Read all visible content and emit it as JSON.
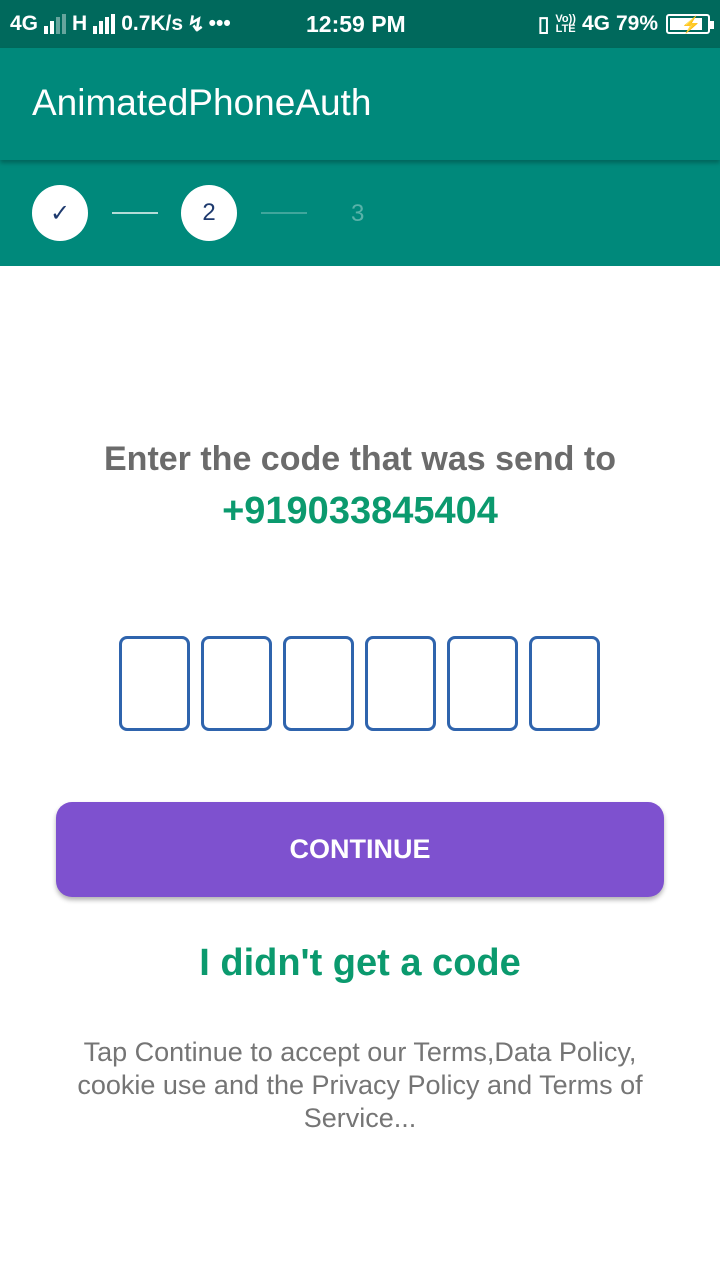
{
  "status_bar": {
    "net1": "4G",
    "net2": "H",
    "speed": "0.7K/s",
    "dots": "•••",
    "time": "12:59 PM",
    "volte_top": "Vo))",
    "volte_bottom": "LTE",
    "net3": "4G",
    "battery": "79%"
  },
  "app_bar": {
    "title": "AnimatedPhoneAuth"
  },
  "stepper": {
    "step1_icon": "check-icon",
    "step1_symbol": "✓",
    "step2_label": "2",
    "step3_label": "3",
    "current_step": 2
  },
  "content": {
    "prompt": "Enter the code that was send to",
    "phone_number": "+919033845404",
    "otp_digits": [
      "",
      "",
      "",
      "",
      "",
      ""
    ],
    "continue_label": "CONTINUE",
    "resend_label": "I didn't get a code",
    "terms_text": "Tap Continue to accept our Terms,Data Policy, cookie use and the Privacy Policy and Terms of Service..."
  },
  "colors": {
    "status_bar": "#00695c",
    "app_bar": "#00897b",
    "accent_green": "#0b9a6e",
    "button_purple": "#7e51cf",
    "otp_border": "#2f64ad",
    "text_gray": "#6b6b6b"
  }
}
